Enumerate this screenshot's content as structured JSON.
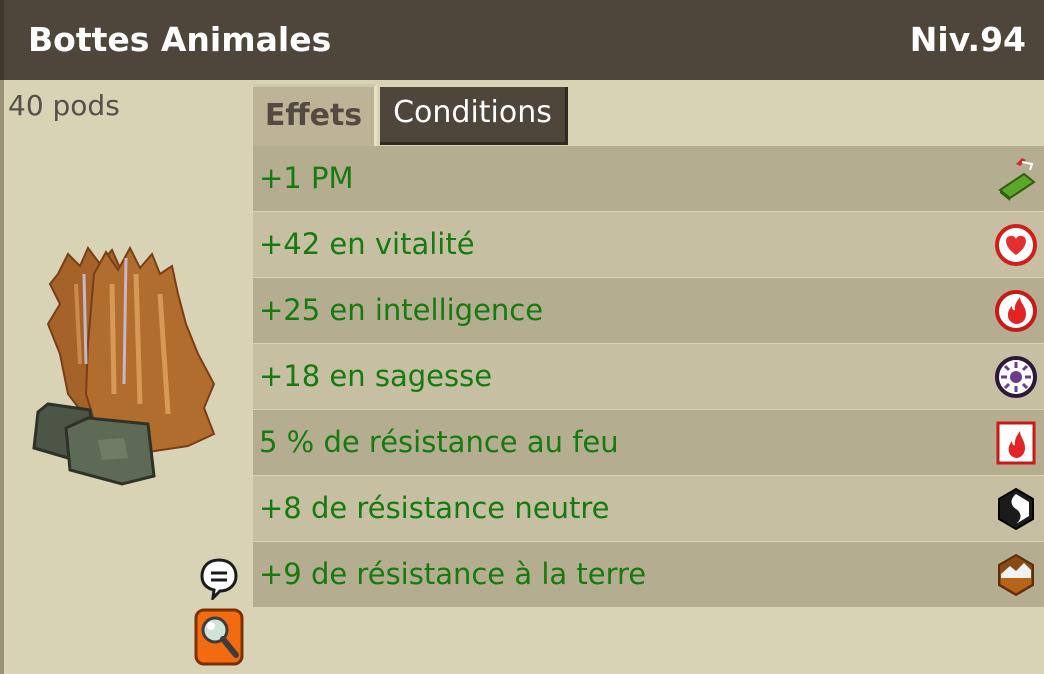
{
  "header": {
    "title": "Bottes Animales",
    "level": "Niv.94"
  },
  "item": {
    "weight": "40 pods",
    "image_icon": "fur-boots-icon"
  },
  "tabs": [
    {
      "label": "Effets",
      "active": true
    },
    {
      "label": "Conditions",
      "active": false
    }
  ],
  "effects": [
    {
      "text": "+1 PM",
      "icon": "movement-points-icon"
    },
    {
      "text": "+42 en vitalité",
      "icon": "vitality-heart-icon"
    },
    {
      "text": "+25 en intelligence",
      "icon": "intelligence-fire-icon"
    },
    {
      "text": "+18 en sagesse",
      "icon": "wisdom-icon"
    },
    {
      "text": "5 % de résistance au feu",
      "icon": "fire-resistance-icon"
    },
    {
      "text": "+8 de résistance neutre",
      "icon": "neutral-resistance-icon"
    },
    {
      "text": "+9 de résistance à la terre",
      "icon": "earth-resistance-icon"
    }
  ],
  "actions": {
    "chat_icon": "chat-bubble-icon",
    "search_icon": "magnifier-icon"
  },
  "colors": {
    "header_bg": "#4e463a",
    "panel_bg": "#d8d3b4",
    "row_dark": "#b5ad90",
    "row_light": "#c7bfa2",
    "effect_text": "#167a10"
  }
}
